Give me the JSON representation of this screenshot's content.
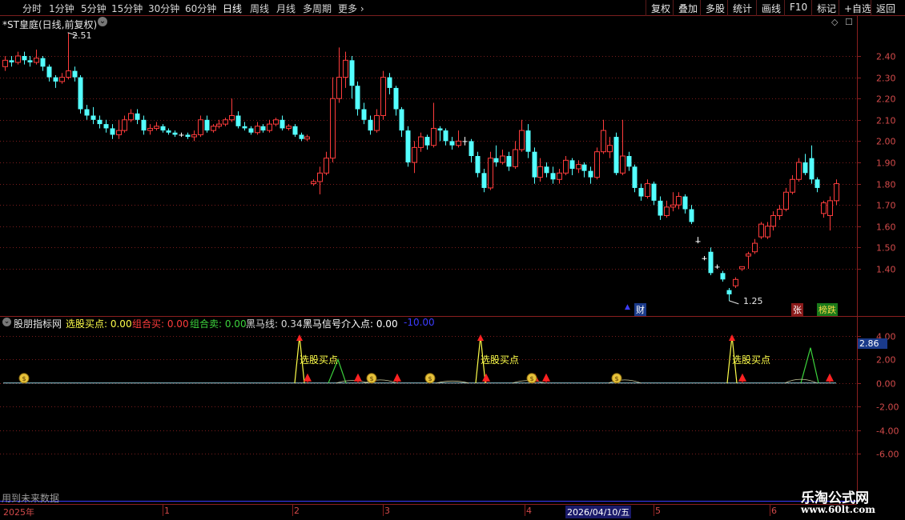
{
  "toolbar": {
    "periods": [
      "分时",
      "1分钟",
      "5分钟",
      "15分钟",
      "30分钟",
      "60分钟",
      "日线",
      "周线",
      "月线",
      "多周期",
      "更多"
    ],
    "active_period": "日线",
    "right_buttons": [
      "复权",
      "叠加",
      "多股",
      "统计",
      "画线",
      "F10",
      "标记",
      "+自选",
      "返回"
    ]
  },
  "main_chart": {
    "title": "*ST皇庭(日线,前复权)",
    "high_label": "2.51",
    "low_label": "1.25",
    "badge_cai": "财",
    "badge_zhang": "张",
    "badge_bangdie": "榜跌",
    "y_ticks": [
      "2.40",
      "2.30",
      "2.20",
      "2.10",
      "2.00",
      "1.90",
      "1.80",
      "1.70",
      "1.60",
      "1.50",
      "1.40"
    ]
  },
  "indicator": {
    "name": "股朋指标网",
    "items": [
      {
        "label": "选股买点: 0.00",
        "color": "#ffff4a"
      },
      {
        "label": "组合买: 0.00",
        "color": "#ff3c3c"
      },
      {
        "label": "组合卖: 0.00",
        "color": "#3cd23c"
      },
      {
        "label": "黑马线: 0.34",
        "color": "#d8d8d8"
      },
      {
        "label": "黑马信号介入点: 0.00",
        "color": "#ffffff"
      },
      {
        "label": "-10.00",
        "color": "#3c3cff"
      }
    ],
    "signal_text": "选股买点",
    "current_value": "2.86",
    "y_ticks": [
      "4.00",
      "2.00",
      "0.00",
      "-2.00",
      "-4.00",
      "-6.00"
    ]
  },
  "footer": {
    "note": "用到未来数据",
    "x_labels": [
      "2025年",
      "1",
      "2",
      "3",
      "4",
      "2026/04/10/五",
      "5",
      "6"
    ],
    "watermark_title": "乐淘公式网",
    "watermark_url": "www.60lt.com"
  },
  "chart_data": {
    "type": "candlestick",
    "ylim": [
      1.25,
      2.51
    ],
    "colors": {
      "up": "#ff3c3c",
      "down": "#54ffff",
      "flat": "#ffffff"
    },
    "candles": [
      [
        2.35,
        2.38,
        2.33,
        2.4
      ],
      [
        2.38,
        2.37,
        2.35,
        2.4
      ],
      [
        2.37,
        2.4,
        2.36,
        2.42
      ],
      [
        2.4,
        2.38,
        2.36,
        2.42
      ],
      [
        2.38,
        2.37,
        2.35,
        2.4
      ],
      [
        2.37,
        2.39,
        2.36,
        2.43
      ],
      [
        2.39,
        2.35,
        2.33,
        2.4
      ],
      [
        2.35,
        2.3,
        2.28,
        2.36
      ],
      [
        2.3,
        2.28,
        2.25,
        2.31
      ],
      [
        2.28,
        2.3,
        2.27,
        2.32
      ],
      [
        2.3,
        2.33,
        2.29,
        2.51
      ],
      [
        2.33,
        2.3,
        2.28,
        2.35
      ],
      [
        2.3,
        2.15,
        2.13,
        2.31
      ],
      [
        2.15,
        2.12,
        2.1,
        2.17
      ],
      [
        2.12,
        2.1,
        2.08,
        2.16
      ],
      [
        2.1,
        2.08,
        2.06,
        2.12
      ],
      [
        2.08,
        2.06,
        2.04,
        2.1
      ],
      [
        2.06,
        2.03,
        2.01,
        2.08
      ],
      [
        2.03,
        2.05,
        2.01,
        2.1
      ],
      [
        2.05,
        2.1,
        2.04,
        2.12
      ],
      [
        2.1,
        2.13,
        2.09,
        2.15
      ],
      [
        2.13,
        2.1,
        2.08,
        2.15
      ],
      [
        2.1,
        2.05,
        2.03,
        2.12
      ],
      [
        2.05,
        2.06,
        2.03,
        2.08
      ],
      [
        2.06,
        2.07,
        2.05,
        2.09
      ],
      [
        2.07,
        2.05,
        2.04,
        2.08
      ],
      [
        2.05,
        2.04,
        2.03,
        2.06
      ],
      [
        2.04,
        2.03,
        2.02,
        2.05
      ],
      [
        2.03,
        2.03,
        2.02,
        2.04
      ],
      [
        2.03,
        2.02,
        2.01,
        2.04
      ],
      [
        2.02,
        2.03,
        2.0,
        2.05
      ],
      [
        2.03,
        2.1,
        2.02,
        2.12
      ],
      [
        2.1,
        2.05,
        2.04,
        2.12
      ],
      [
        2.05,
        2.07,
        2.04,
        2.08
      ],
      [
        2.07,
        2.08,
        2.06,
        2.1
      ],
      [
        2.08,
        2.1,
        2.07,
        2.11
      ],
      [
        2.1,
        2.12,
        2.09,
        2.2
      ],
      [
        2.12,
        2.07,
        2.06,
        2.14
      ],
      [
        2.07,
        2.06,
        2.05,
        2.09
      ],
      [
        2.06,
        2.04,
        2.03,
        2.07
      ],
      [
        2.04,
        2.07,
        2.03,
        2.09
      ],
      [
        2.07,
        2.05,
        2.04,
        2.08
      ],
      [
        2.05,
        2.08,
        2.04,
        2.1
      ],
      [
        2.08,
        2.1,
        2.07,
        2.11
      ],
      [
        2.1,
        2.06,
        2.05,
        2.12
      ],
      [
        2.06,
        2.07,
        2.05,
        2.08
      ],
      [
        2.07,
        2.03,
        2.02,
        2.08
      ],
      [
        2.03,
        2.01,
        2.0,
        2.04
      ],
      [
        2.01,
        2.02,
        2.0,
        2.03
      ],
      [
        1.8,
        1.81,
        1.79,
        1.82
      ],
      [
        1.81,
        1.85,
        1.75,
        1.88
      ],
      [
        1.85,
        1.92,
        1.84,
        1.95
      ],
      [
        1.92,
        2.2,
        1.9,
        2.3
      ],
      [
        2.2,
        2.3,
        2.18,
        2.44
      ],
      [
        2.3,
        2.38,
        2.25,
        2.42
      ],
      [
        2.38,
        2.26,
        2.2,
        2.4
      ],
      [
        2.26,
        2.15,
        2.12,
        2.28
      ],
      [
        2.15,
        2.1,
        2.08,
        2.18
      ],
      [
        2.1,
        2.05,
        2.03,
        2.12
      ],
      [
        2.05,
        2.12,
        2.04,
        2.15
      ],
      [
        2.12,
        2.3,
        2.1,
        2.33
      ],
      [
        2.3,
        2.25,
        2.22,
        2.32
      ],
      [
        2.25,
        2.15,
        2.12,
        2.26
      ],
      [
        2.15,
        2.05,
        2.02,
        2.16
      ],
      [
        2.05,
        1.9,
        1.88,
        2.07
      ],
      [
        1.9,
        1.97,
        1.85,
        2.0
      ],
      [
        1.97,
        2.02,
        1.95,
        2.04
      ],
      [
        2.02,
        1.98,
        1.96,
        2.03
      ],
      [
        1.98,
        2.06,
        1.97,
        2.18
      ],
      [
        2.06,
        2.05,
        2.0,
        2.07
      ],
      [
        2.05,
        2.0,
        1.98,
        2.06
      ],
      [
        2.0,
        1.98,
        1.96,
        2.02
      ],
      [
        1.98,
        2.0,
        1.97,
        2.05
      ],
      [
        2.0,
        2.0,
        1.98,
        2.02
      ],
      [
        2.0,
        1.93,
        1.9,
        2.01
      ],
      [
        1.93,
        1.85,
        1.83,
        1.95
      ],
      [
        1.85,
        1.78,
        1.76,
        1.87
      ],
      [
        1.78,
        1.92,
        1.77,
        1.95
      ],
      [
        1.92,
        1.9,
        1.88,
        1.98
      ],
      [
        1.9,
        1.93,
        1.89,
        1.96
      ],
      [
        1.93,
        1.88,
        1.86,
        1.95
      ],
      [
        1.88,
        1.96,
        1.87,
        2.0
      ],
      [
        1.96,
        2.05,
        1.95,
        2.1
      ],
      [
        2.05,
        1.95,
        1.92,
        2.08
      ],
      [
        1.95,
        1.83,
        1.8,
        1.97
      ],
      [
        1.83,
        1.88,
        1.81,
        1.92
      ],
      [
        1.88,
        1.85,
        1.83,
        1.9
      ],
      [
        1.85,
        1.82,
        1.8,
        1.88
      ],
      [
        1.82,
        1.85,
        1.8,
        1.87
      ],
      [
        1.85,
        1.91,
        1.84,
        1.93
      ],
      [
        1.91,
        1.87,
        1.84,
        1.92
      ],
      [
        1.87,
        1.89,
        1.85,
        1.91
      ],
      [
        1.89,
        1.86,
        1.83,
        1.9
      ],
      [
        1.86,
        1.83,
        1.8,
        1.88
      ],
      [
        1.83,
        1.95,
        1.82,
        1.97
      ],
      [
        1.95,
        2.05,
        1.94,
        2.1
      ],
      [
        1.95,
        1.98,
        1.92,
        2.02
      ],
      [
        2.02,
        1.85,
        1.84,
        2.04
      ],
      [
        1.85,
        1.93,
        1.84,
        2.1
      ],
      [
        1.93,
        1.88,
        1.86,
        1.95
      ],
      [
        1.88,
        1.78,
        1.76,
        1.89
      ],
      [
        1.78,
        1.74,
        1.72,
        1.8
      ],
      [
        1.74,
        1.8,
        1.73,
        1.82
      ],
      [
        1.8,
        1.72,
        1.7,
        1.81
      ],
      [
        1.72,
        1.65,
        1.63,
        1.74
      ],
      [
        1.65,
        1.69,
        1.64,
        1.72
      ],
      [
        1.69,
        1.7,
        1.67,
        1.76
      ],
      [
        1.7,
        1.74,
        1.68,
        1.76
      ],
      [
        1.74,
        1.68,
        1.66,
        1.75
      ],
      [
        1.68,
        1.62,
        1.61,
        1.7
      ],
      [
        1.53,
        1.53,
        1.52,
        1.55
      ],
      [
        1.45,
        1.45,
        1.44,
        1.46
      ],
      [
        1.48,
        1.38,
        1.37,
        1.5
      ],
      [
        1.41,
        1.41,
        1.4,
        1.42
      ],
      [
        1.38,
        1.35,
        1.34,
        1.39
      ],
      [
        1.3,
        1.28,
        1.25,
        1.31
      ],
      [
        1.32,
        1.35,
        1.31,
        1.36
      ],
      [
        1.4,
        1.41,
        1.39,
        1.41
      ],
      [
        1.46,
        1.47,
        1.4,
        1.48
      ],
      [
        1.48,
        1.52,
        1.47,
        1.54
      ],
      [
        1.55,
        1.61,
        1.54,
        1.62
      ],
      [
        1.55,
        1.6,
        1.54,
        1.62
      ],
      [
        1.6,
        1.65,
        1.58,
        1.67
      ],
      [
        1.65,
        1.68,
        1.63,
        1.7
      ],
      [
        1.68,
        1.76,
        1.67,
        1.78
      ],
      [
        1.76,
        1.82,
        1.75,
        1.84
      ],
      [
        1.82,
        1.9,
        1.81,
        1.92
      ],
      [
        1.9,
        1.85,
        1.84,
        1.94
      ],
      [
        1.92,
        1.82,
        1.8,
        1.98
      ],
      [
        1.82,
        1.78,
        1.76,
        1.83
      ],
      [
        1.66,
        1.71,
        1.64,
        1.72
      ],
      [
        1.65,
        1.72,
        1.58,
        1.74
      ],
      [
        1.72,
        1.8,
        1.7,
        1.82
      ]
    ]
  }
}
